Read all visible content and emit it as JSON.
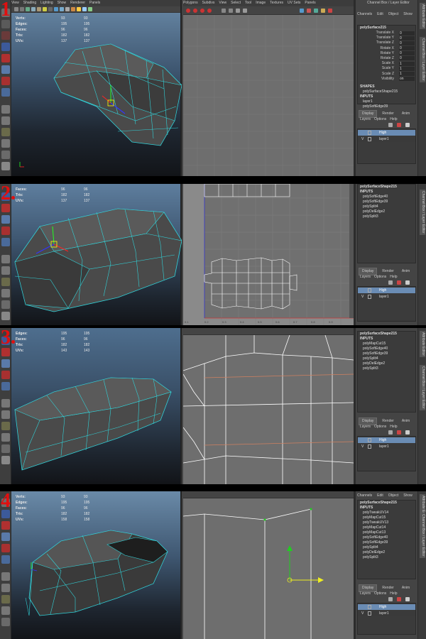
{
  "viewport_menu": [
    "View",
    "Shading",
    "Lighting",
    "Show",
    "Renderer",
    "Panels"
  ],
  "uv_menu": [
    "Polygons",
    "Subdivs",
    "View",
    "Select",
    "Tool",
    "Image",
    "Textures",
    "UV Sets",
    "Panels"
  ],
  "channel_box": {
    "title": "Channel Box / Layer Editor",
    "menu": [
      "Channels",
      "Edit",
      "Object",
      "Show"
    ],
    "object": "polySurface215",
    "attributes": [
      {
        "name": "Translate X",
        "value": "0"
      },
      {
        "name": "Translate Y",
        "value": "0"
      },
      {
        "name": "Translate Z",
        "value": "0"
      },
      {
        "name": "Rotate X",
        "value": "0"
      },
      {
        "name": "Rotate Y",
        "value": "0"
      },
      {
        "name": "Rotate Z",
        "value": "0"
      },
      {
        "name": "Scale X",
        "value": "1"
      },
      {
        "name": "Scale Y",
        "value": "1"
      },
      {
        "name": "Scale Z",
        "value": "1"
      },
      {
        "name": "Visibility",
        "value": "on"
      }
    ],
    "shapes_label": "SHAPES",
    "shape_name": "polySurfaceShape215",
    "inputs_label": "INPUTS",
    "layer_input": "layer1",
    "input_soft": "polySoftEdge39"
  },
  "vtabs": {
    "attribute_editor": "Attribute Editor",
    "channel_box": "Channel Box / Layer Editor"
  },
  "layer_editor": {
    "tabs": [
      "Display",
      "Render",
      "Anim"
    ],
    "menu": [
      "Layers",
      "Options",
      "Help"
    ],
    "layers": [
      {
        "v": "",
        "name": "High",
        "selected": true
      },
      {
        "v": "V",
        "name": "layer1",
        "selected": false
      }
    ]
  },
  "stats_labels": {
    "verts": "Verts:",
    "edges": "Edges:",
    "faces": "Faces:",
    "tris": "Tris:",
    "uvs": "UVs:"
  },
  "panels": [
    {
      "number": "1",
      "stats": [
        {
          "label": "Verts:",
          "a": "93",
          "b": "93",
          "c": "0"
        },
        {
          "label": "Edges:",
          "a": "195",
          "b": "195",
          "c": "0"
        },
        {
          "label": "Faces:",
          "a": "96",
          "b": "96",
          "c": "0"
        },
        {
          "label": "Tris:",
          "a": "182",
          "b": "182",
          "c": "0"
        },
        {
          "label": "UVs:",
          "a": "137",
          "b": "137",
          "c": "0"
        }
      ],
      "bottom_stats": [
        {
          "label": "Verts:",
          "a": "93",
          "b": "93"
        },
        {
          "label": "Edges:",
          "a": "195",
          "b": "195"
        },
        {
          "label": "Faces:",
          "a": "96",
          "b": "96"
        },
        {
          "label": "Tris:",
          "a": "182",
          "b": "182"
        },
        {
          "label": "UVs:",
          "a": "137",
          "b": "137"
        }
      ]
    },
    {
      "number": "2",
      "stats": [
        {
          "label": "Faces:",
          "a": "96",
          "b": "96"
        },
        {
          "label": "Tris:",
          "a": "182",
          "b": "182"
        },
        {
          "label": "UVs:",
          "a": "137",
          "b": "137"
        }
      ],
      "inputs_list": [
        "polySurfaceShape215",
        "INPUTS",
        "polySoftEdge40",
        "polySoftEdge39",
        "polySplit4",
        "polyDelEdge2",
        "polySplit3"
      ],
      "uv_ticks": [
        "0.1",
        "0.2",
        "0.3",
        "0.4",
        "0.5",
        "0.6",
        "0.7",
        "0.8",
        "0.9"
      ]
    },
    {
      "number": "3",
      "stats": [
        {
          "label": "Edges:",
          "a": "195",
          "b": "195"
        },
        {
          "label": "Faces:",
          "a": "96",
          "b": "96"
        },
        {
          "label": "Tris:",
          "a": "182",
          "b": "182"
        },
        {
          "label": "UVs:",
          "a": "143",
          "b": "143"
        }
      ],
      "inputs_list": [
        "polySurfaceShape215",
        "INPUTS",
        "polyMapCut15",
        "polySoftEdge40",
        "polySoftEdge39",
        "polySplit4",
        "polyDelEdge2",
        "polySplit3"
      ]
    },
    {
      "number": "4",
      "stats": [
        {
          "label": "Verts:",
          "a": "93",
          "b": "93"
        },
        {
          "label": "Edges:",
          "a": "195",
          "b": "195"
        },
        {
          "label": "Faces:",
          "a": "96",
          "b": "96"
        },
        {
          "label": "Tris:",
          "a": "182",
          "b": "182"
        },
        {
          "label": "UVs:",
          "a": "158",
          "b": "158"
        }
      ],
      "inputs_list": [
        "polySurfaceShape215",
        "INPUTS",
        "polyTweakUV14",
        "polyMapCut15",
        "polyTweakUV13",
        "polyMapCut14",
        "polyMapCut13",
        "polySoftEdge40",
        "polySoftEdge39",
        "polySplit4",
        "polyDelEdge2",
        "polySplit3"
      ]
    }
  ]
}
